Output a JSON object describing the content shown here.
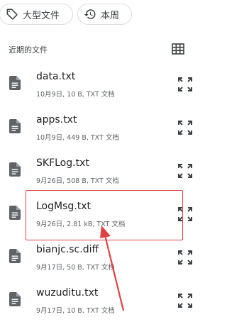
{
  "filters": {
    "large_files_label": "大型文件",
    "this_week_label": "本周"
  },
  "section": {
    "title": "近期的文件"
  },
  "files": [
    {
      "name": "data.txt",
      "meta": "10月9日, 10 B, TXT 文档"
    },
    {
      "name": "apps.txt",
      "meta": "10月9日, 449 B, TXT 文档"
    },
    {
      "name": "SKFLog.txt",
      "meta": "9月26日, 508 B, TXT 文档"
    },
    {
      "name": "LogMsg.txt",
      "meta": "9月26日, 2.81 kB, TXT 文档"
    },
    {
      "name": "bianjc.sc.diff",
      "meta": "9月17日, 50 B, TXT 文档"
    },
    {
      "name": "wuzuditu.txt",
      "meta": "9月17日, 10 B, TXT 文档"
    }
  ],
  "annotation": {
    "highlight_color": "#e04040"
  },
  "colors": {
    "icon": "#5f6368",
    "text": "#202124",
    "meta": "#5f6368"
  }
}
